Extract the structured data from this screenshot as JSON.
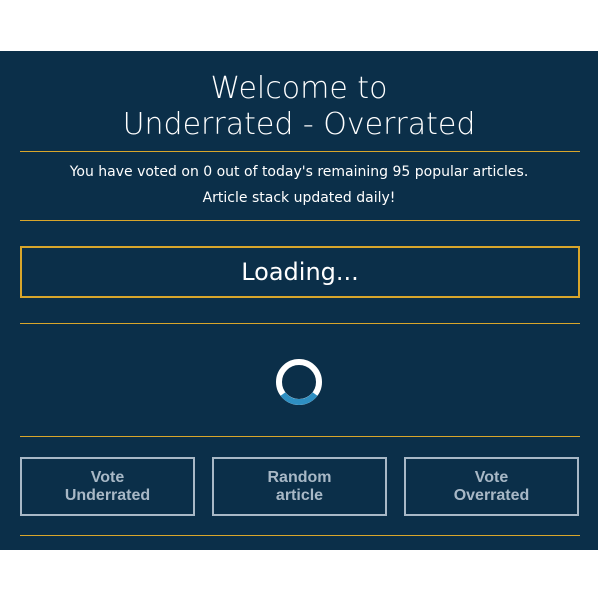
{
  "header": {
    "title_line1": "Welcome to",
    "title_line2": "Underrated - Overrated"
  },
  "info": {
    "line1": "You have voted on 0 out of today's remaining 95 popular articles.",
    "line2": "Article stack updated daily!"
  },
  "status": {
    "loading_text": "Loading..."
  },
  "buttons": {
    "vote_underrated": {
      "line1": "Vote",
      "line2": "Underrated"
    },
    "random_article": {
      "line1": "Random",
      "line2": "article"
    },
    "vote_overrated": {
      "line1": "Vote",
      "line2": "Overrated"
    }
  },
  "colors": {
    "background": "#0b2f49",
    "accent": "#d9a62b",
    "button_border": "#a8b8c6",
    "spinner_track": "#ffffff",
    "spinner_active": "#2e8fc2"
  },
  "icons": {
    "spinner": "loading-spinner-icon"
  }
}
